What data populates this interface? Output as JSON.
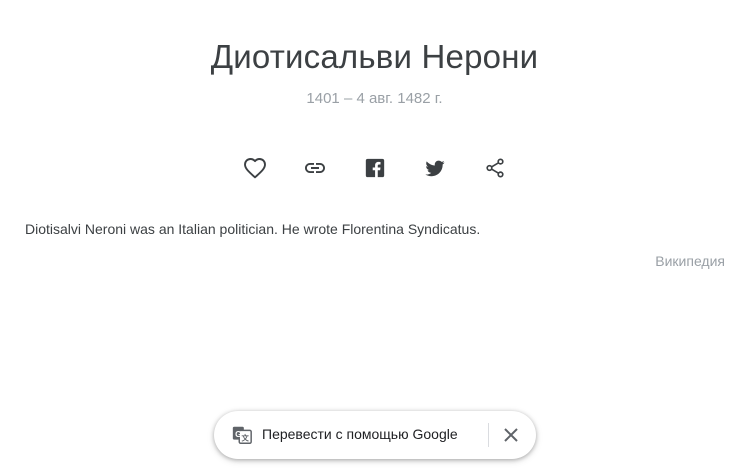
{
  "person": {
    "name": "Диотисальви Нерони",
    "dates": "1401 – 4 авг. 1482 г."
  },
  "actions": [
    {
      "name": "like",
      "icon": "heart-outline-icon"
    },
    {
      "name": "copy-link",
      "icon": "link-icon"
    },
    {
      "name": "facebook",
      "icon": "facebook-icon"
    },
    {
      "name": "twitter",
      "icon": "twitter-icon"
    },
    {
      "name": "share",
      "icon": "share-icon"
    }
  ],
  "description": "Diotisalvi Neroni was an Italian politician. He wrote Florentina Syndicatus.",
  "source_label": "Википедия",
  "translate_bar": {
    "label": "Перевести с помощью Google",
    "translate_icon": "google-translate-icon",
    "close_icon": "close-icon"
  },
  "colors": {
    "title": "#3c4043",
    "muted": "#9aa0a6",
    "icon": "#3c4043"
  }
}
